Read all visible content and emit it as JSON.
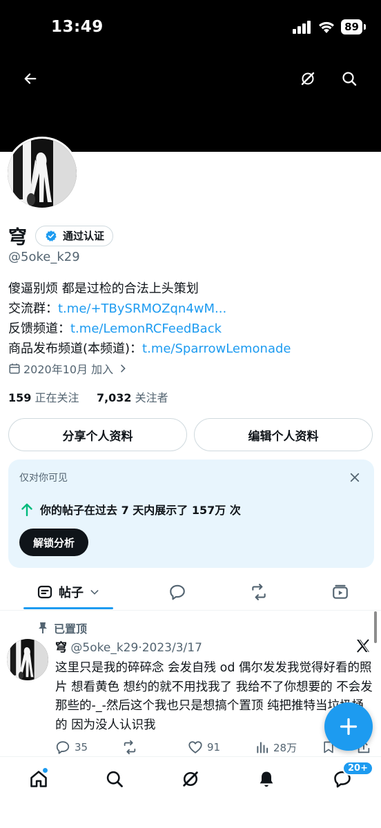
{
  "status_bar": {
    "time": "13:49",
    "battery": "89"
  },
  "header": {
    "back_icon": "arrow-left-icon",
    "grok_icon": "grok-icon",
    "search_icon": "search-icon"
  },
  "profile": {
    "display_name": "穹",
    "verified_label": "通过认证",
    "handle": "@5oke_k29",
    "bio": {
      "line1": "傻逼别烦 都是过检的合法上头策划",
      "line2_label": "交流群：",
      "line2_link": "t.me/+TBySRMOZqn4wM...",
      "line3_label": "反馈频道：",
      "line3_link": "t.me/LemonRCFeedBack",
      "line4_label": "商品发布频道(本频道)：",
      "line4_link": "t.me/SparrowLemonade"
    },
    "joined": "2020年10月 加入",
    "following_count": "159",
    "following_label": "正在关注",
    "followers_count": "7,032",
    "followers_label": "关注者"
  },
  "buttons": {
    "share": "分享个人资料",
    "edit": "编辑个人资料"
  },
  "analytics": {
    "visibility": "仅对你可见",
    "impressions": "你的帖子在过去 7 天内展示了 157万 次",
    "unlock": "解锁分析",
    "accent": "#00ba7c"
  },
  "tabs": {
    "posts": "帖子"
  },
  "tweet": {
    "pinned_label": "已置顶",
    "author": "穹",
    "handle": "@5oke_k29",
    "date": "2023/3/17",
    "text": "这里只是我的碎碎念 会发自残 od 偶尔发发我觉得好看的照片 想看黄色 想约的就不用找我了 我给不了你想要的 不会发那些的-_-然后这个我也只是想搞个置顶 纯把推特当垃圾桶的 因为没人认识我",
    "replies": "35",
    "likes": "91",
    "views": "28万"
  },
  "bottom_nav": {
    "messages_badge": "20+"
  },
  "colors": {
    "accent": "#1d9bf0",
    "text": "#0f1419",
    "muted": "#536471"
  }
}
